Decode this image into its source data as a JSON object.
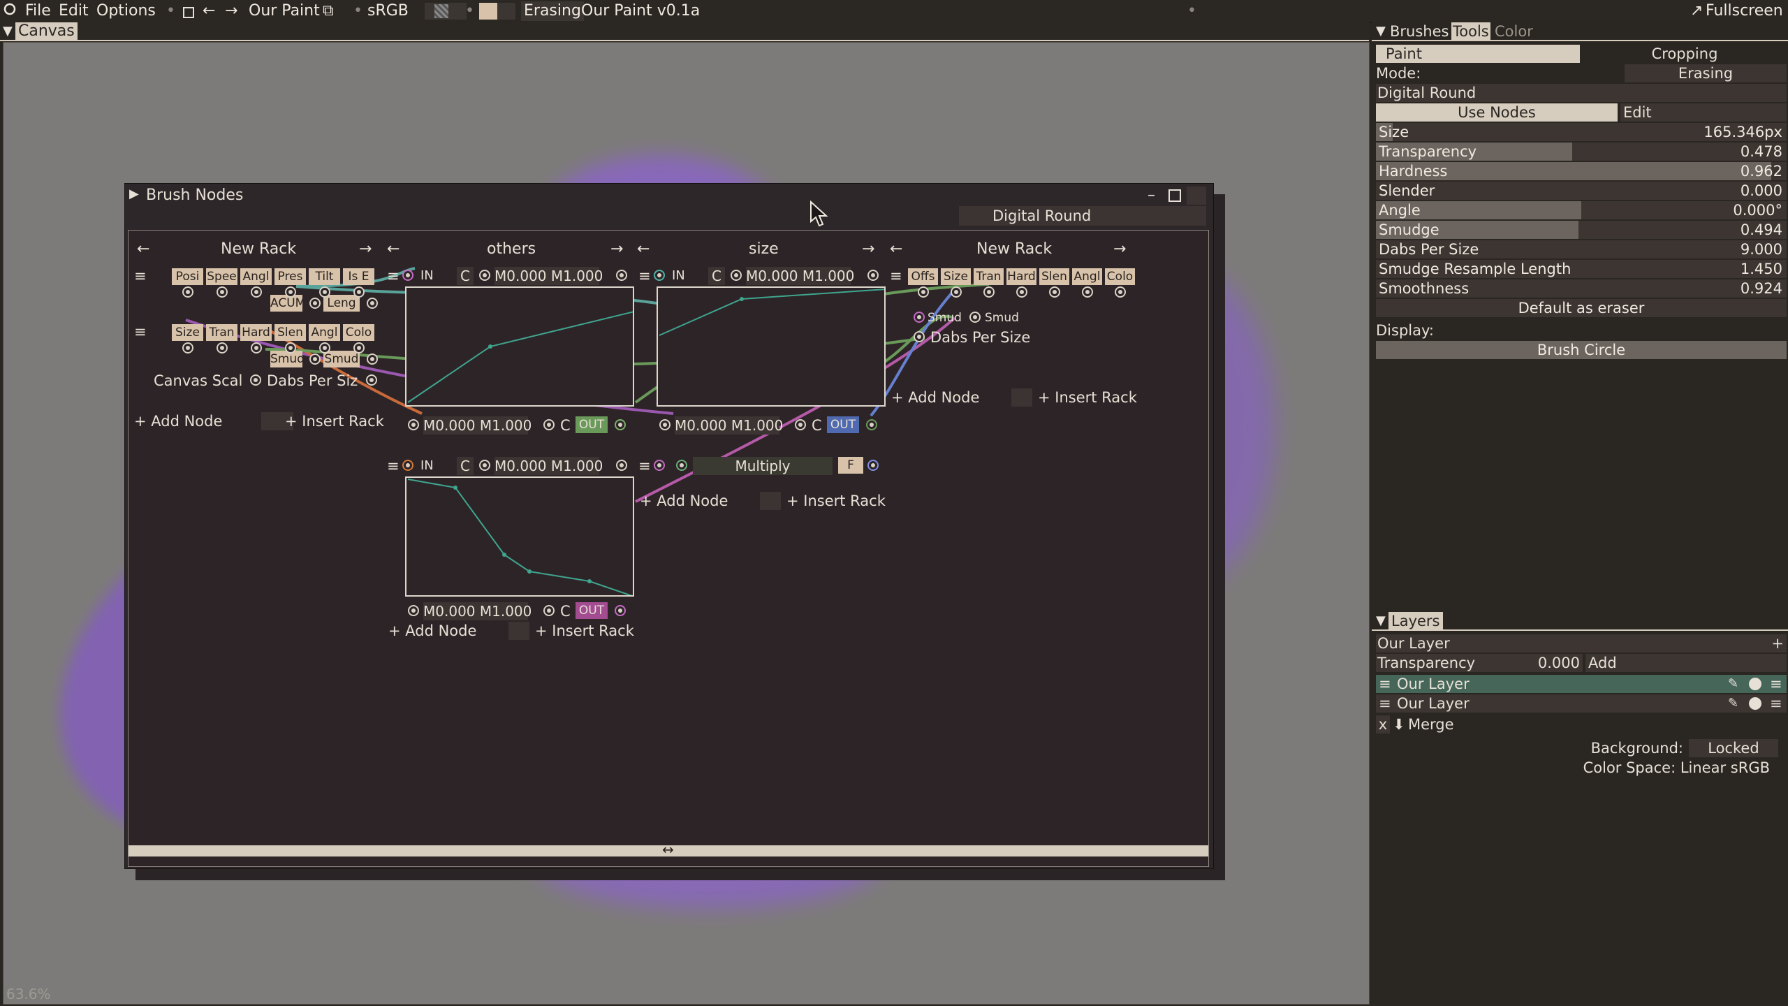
{
  "menubar": {
    "file": "File",
    "edit": "Edit",
    "options": "Options",
    "doc_name": "Our Paint",
    "color_space": "sRGB",
    "mode": "Erasing",
    "app_title": "Our Paint v0.1a",
    "fullscreen": "Fullscreen"
  },
  "canvas": {
    "header": "Canvas",
    "zoom": "63.6%"
  },
  "brush_nodes": {
    "title": "Brush Nodes",
    "brush_name": "Digital Round",
    "racks": [
      {
        "title": "New Rack"
      },
      {
        "title": "others"
      },
      {
        "title": "size"
      },
      {
        "title": "New Rack"
      }
    ],
    "input_node": {
      "row1": [
        "Posi",
        "Spee",
        "Angl",
        "Pres",
        "Tilt",
        "Is E"
      ],
      "row1b": [
        "ACUM",
        "Leng"
      ],
      "row2": [
        "Size",
        "Tran",
        "Hard",
        "Slen",
        "Angl",
        "Colo"
      ],
      "row2b": [
        "Smud",
        "Smud"
      ],
      "canvas_scale": "Canvas Scal",
      "dabs": "Dabs Per Siz"
    },
    "curve_in": "IN",
    "curve_c": "C",
    "curve_range": "M0.000 M1.000",
    "curve_out": "OUT",
    "multiply": "Multiply",
    "f_label": "F",
    "output_node": {
      "row": [
        "Offs",
        "Size",
        "Tran",
        "Hard",
        "Slen",
        "Angl",
        "Colo"
      ],
      "smud1": "Smud",
      "smud2": "Smud",
      "dabs": "Dabs Per Size"
    },
    "add_node": "+ Add Node",
    "insert_rack": "+ Insert Rack"
  },
  "tools_panel": {
    "tabs": [
      "Brushes",
      "Tools",
      "Color"
    ],
    "paint": "Paint",
    "cropping": "Cropping",
    "mode_label": "Mode:",
    "mode_value": "Erasing",
    "brush": "Digital Round",
    "use_nodes": "Use Nodes",
    "edit": "Edit",
    "sliders": [
      {
        "label": "Size",
        "value": "165.346px",
        "fraction": 0.04
      },
      {
        "label": "Transparency",
        "value": "0.478",
        "fraction": 0.478
      },
      {
        "label": "Hardness",
        "value": "0.962",
        "fraction": 0.962
      },
      {
        "label": "Slender",
        "value": "0.000",
        "fraction": 0.0
      },
      {
        "label": "Angle",
        "value": "0.000°",
        "fraction": 0.5
      },
      {
        "label": "Smudge",
        "value": "0.494",
        "fraction": 0.494
      },
      {
        "label": "Dabs Per Size",
        "value": "9.000",
        "fraction": 0.0
      },
      {
        "label": "Smudge Resample Length",
        "value": "1.450",
        "fraction": 0.0
      },
      {
        "label": "Smoothness",
        "value": "0.924",
        "fraction": 0.0
      }
    ],
    "default_eraser": "Default as eraser",
    "display_label": "Display:",
    "display_value": "Brush Circle"
  },
  "layers_panel": {
    "header": "Layers",
    "current": "Our Layer",
    "add_plus": "+",
    "transparency_label": "Transparency",
    "transparency_value": "0.000",
    "blend": "Add",
    "layers": [
      {
        "name": "Our Layer"
      },
      {
        "name": "Our Layer"
      }
    ],
    "x": "x",
    "merge": "Merge",
    "background_label": "Background:",
    "background_value": "Locked",
    "color_space": "Color Space: Linear sRGB"
  }
}
